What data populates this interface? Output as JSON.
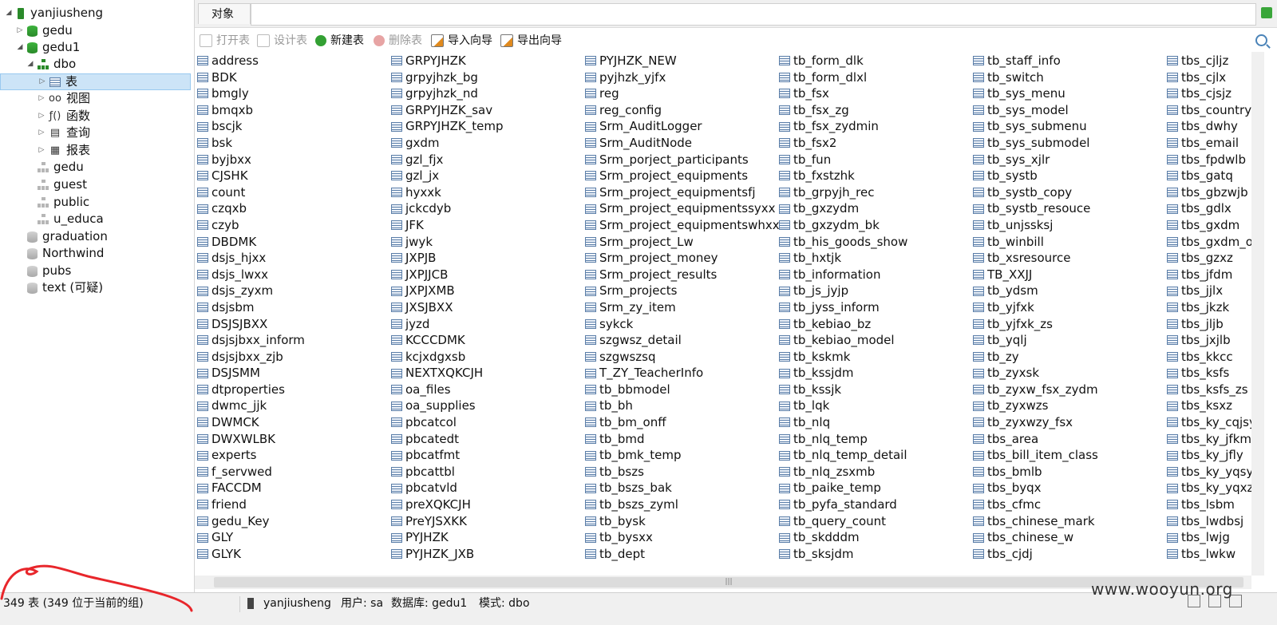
{
  "sidebar": {
    "items": [
      {
        "label": "yanjiusheng",
        "icon": "connection-icon",
        "arrow": "◢",
        "level": 0
      },
      {
        "label": "gedu",
        "icon": "database-icon",
        "arrow": "▷",
        "level": 1
      },
      {
        "label": "gedu1",
        "icon": "database-icon",
        "arrow": "◢",
        "level": 1
      },
      {
        "label": "dbo",
        "icon": "schema-icon",
        "arrow": "◢",
        "level": 2
      },
      {
        "label": "表",
        "icon": "table-icon",
        "arrow": "▷",
        "level": 3,
        "selected": true
      },
      {
        "label": "视图",
        "icon": "view-icon",
        "arrow": "▷",
        "level": 3
      },
      {
        "label": "函数",
        "icon": "function-icon",
        "arrow": "▷",
        "level": 3
      },
      {
        "label": "查询",
        "icon": "query-icon",
        "arrow": "▷",
        "level": 3
      },
      {
        "label": "报表",
        "icon": "report-icon",
        "arrow": "▷",
        "level": 3
      },
      {
        "label": "gedu",
        "icon": "schema-grey-icon",
        "arrow": "",
        "level": 2
      },
      {
        "label": "guest",
        "icon": "schema-grey-icon",
        "arrow": "",
        "level": 2
      },
      {
        "label": "public",
        "icon": "schema-grey-icon",
        "arrow": "",
        "level": 2
      },
      {
        "label": "u_educa",
        "icon": "schema-grey-icon",
        "arrow": "",
        "level": 2
      },
      {
        "label": "graduation",
        "icon": "database-grey-icon",
        "arrow": "",
        "level": 1
      },
      {
        "label": "Northwind",
        "icon": "database-grey-icon",
        "arrow": "",
        "level": 1
      },
      {
        "label": "pubs",
        "icon": "database-grey-icon",
        "arrow": "",
        "level": 1
      },
      {
        "label": "text (可疑)",
        "icon": "database-grey-icon",
        "arrow": "",
        "level": 1
      }
    ]
  },
  "tabs": {
    "objects_label": "对象"
  },
  "toolbar": {
    "open_table": "打开表",
    "design_table": "设计表",
    "new_table": "新建表",
    "delete_table": "删除表",
    "import_wizard": "导入向导",
    "export_wizard": "导出向导"
  },
  "tables": {
    "columns": [
      [
        "address",
        "BDK",
        "bmgly",
        "bmqxb",
        "bscjk",
        "bsk",
        "byjbxx",
        "CJSHK",
        "count",
        "czqxb",
        "czyb",
        "DBDMK",
        "dsjs_hjxx",
        "dsjs_lwxx",
        "dsjs_zyxm",
        "dsjsbm",
        "DSJSJBXX",
        "dsjsjbxx_inform",
        "dsjsjbxx_zjb",
        "DSJSMM",
        "dtproperties",
        "dwmc_jjk",
        "DWMCK",
        "DWXWLBK",
        "experts",
        "f_servwed",
        "FACCDM",
        "friend",
        "gedu_Key",
        "GLY",
        "GLYK"
      ],
      [
        "GRPYJHZK",
        "grpyjhzk_bg",
        "grpyjhzk_nd",
        "GRPYJHZK_sav",
        "GRPYJHZK_temp",
        "gxdm",
        "gzl_fjx",
        "gzl_jx",
        "hyxxk",
        "jckcdyb",
        "JFK",
        "jwyk",
        "JXPJB",
        "JXPJJCB",
        "JXPJXMB",
        "JXSJBXX",
        "jyzd",
        "KCCCDMK",
        "kcjxdgxsb",
        "NEXTXQKCJH",
        "oa_files",
        "oa_supplies",
        "pbcatcol",
        "pbcatedt",
        "pbcatfmt",
        "pbcattbl",
        "pbcatvld",
        "preXQKCJH",
        "PreYJSXKK",
        "PYJHZK",
        "PYJHZK_JXB"
      ],
      [
        "PYJHZK_NEW",
        "pyjhzk_yjfx",
        "reg",
        "reg_config",
        "Srm_AuditLogger",
        "Srm_AuditNode",
        "Srm_porject_participants",
        "Srm_project_equipments",
        "Srm_project_equipmentsfj",
        "Srm_project_equipmentssyxx",
        "Srm_project_equipmentswhxx",
        "Srm_project_Lw",
        "Srm_project_money",
        "Srm_project_results",
        "Srm_projects",
        "Srm_zy_item",
        "sykck",
        "szgwsz_detail",
        "szgwszsq",
        "T_ZY_TeacherInfo",
        "tb_bbmodel",
        "tb_bh",
        "tb_bm_onff",
        "tb_bmd",
        "tb_bmk_temp",
        "tb_bszs",
        "tb_bszs_bak",
        "tb_bszs_zyml",
        "tb_bysk",
        "tb_bysxx",
        "tb_dept"
      ],
      [
        "tb_form_dlk",
        "tb_form_dlxl",
        "tb_fsx",
        "tb_fsx_zg",
        "tb_fsx_zydmin",
        "tb_fsx2",
        "tb_fun",
        "tb_fxstzhk",
        "tb_grpyjh_rec",
        "tb_gxzydm",
        "tb_gxzydm_bk",
        "tb_his_goods_show",
        "tb_hxtjk",
        "tb_information",
        "tb_js_jyjp",
        "tb_jyss_inform",
        "tb_kebiao_bz",
        "tb_kebiao_model",
        "tb_kskmk",
        "tb_kssjdm",
        "tb_kssjk",
        "tb_lqk",
        "tb_nlq",
        "tb_nlq_temp",
        "tb_nlq_temp_detail",
        "tb_nlq_zsxmb",
        "tb_paike_temp",
        "tb_pyfa_standard",
        "tb_query_count",
        "tb_skdddm",
        "tb_sksjdm"
      ],
      [
        "tb_staff_info",
        "tb_switch",
        "tb_sys_menu",
        "tb_sys_model",
        "tb_sys_submenu",
        "tb_sys_submodel",
        "tb_sys_xjlr",
        "tb_systb",
        "tb_systb_copy",
        "tb_systb_resouce",
        "tb_unjssksj",
        "tb_winbill",
        "tb_xsresource",
        "TB_XXJJ",
        "tb_ydsm",
        "tb_yjfxk",
        "tb_yjfxk_zs",
        "tb_yqlj",
        "tb_zy",
        "tb_zyxsk",
        "tb_zyxw_fsx_zydm",
        "tb_zyxwzs",
        "tb_zyxwzy_fsx",
        "tbs_area",
        "tbs_bill_item_class",
        "tbs_bmlb",
        "tbs_byqx",
        "tbs_cfmc",
        "tbs_chinese_mark",
        "tbs_chinese_w",
        "tbs_cjdj"
      ],
      [
        "tbs_cjljz",
        "tbs_cjlx",
        "tbs_cjsjz",
        "tbs_country",
        "tbs_dwhy",
        "tbs_email",
        "tbs_fpdwlb",
        "tbs_gatq",
        "tbs_gbzwjb",
        "tbs_gdlx",
        "tbs_gxdm",
        "tbs_gxdm_o",
        "tbs_gzxz",
        "tbs_jfdm",
        "tbs_jjlx",
        "tbs_jkzk",
        "tbs_jljb",
        "tbs_jxjlb",
        "tbs_kkcc",
        "tbs_ksfs",
        "tbs_ksfs_zs",
        "tbs_ksxz",
        "tbs_ky_cqjsy",
        "tbs_ky_jfkm",
        "tbs_ky_jfly",
        "tbs_ky_yqsyf",
        "tbs_ky_yqxz",
        "tbs_lsbm",
        "tbs_lwdbsj",
        "tbs_lwjg",
        "tbs_lwkw"
      ]
    ]
  },
  "statusbar": {
    "count_text": "349 表 (349 位于当前的组)",
    "connection": "yanjiusheng",
    "user": "用户: sa",
    "database": "数据库: gedu1",
    "schema": "模式: dbo"
  },
  "watermark": "www.wooyun.org",
  "colors": {
    "annotation": "#e8262b",
    "accent_green": "#2a8a2a",
    "selection": "#cce4f7"
  }
}
